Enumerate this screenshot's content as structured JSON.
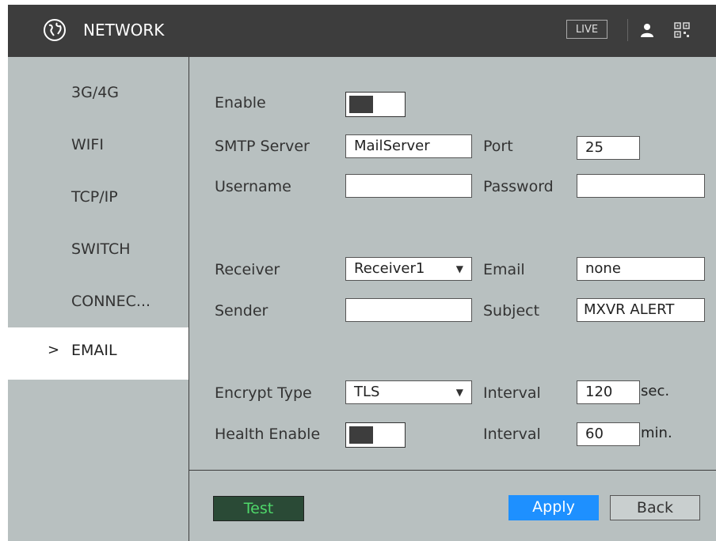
{
  "header": {
    "title": "NETWORK",
    "live_label": "LIVE"
  },
  "sidebar": {
    "items": [
      {
        "label": "3G/4G"
      },
      {
        "label": "WIFI"
      },
      {
        "label": "TCP/IP"
      },
      {
        "label": "SWITCH"
      },
      {
        "label": "CONNEC..."
      },
      {
        "label": "EMAIL",
        "chevron": ">"
      }
    ]
  },
  "form": {
    "enable_label": "Enable",
    "smtp_server_label": "SMTP Server",
    "smtp_server_value": "MailServer",
    "port_label": "Port",
    "port_value": "25",
    "username_label": "Username",
    "username_value": "",
    "password_label": "Password",
    "password_value": "",
    "receiver_label": "Receiver",
    "receiver_value": "Receiver1",
    "email_label": "Email",
    "email_value": "none",
    "sender_label": "Sender",
    "sender_value": "",
    "subject_label": "Subject",
    "subject_value": "MXVR ALERT",
    "encrypt_label": "Encrypt Type",
    "encrypt_value": "TLS",
    "interval_label": "Interval",
    "interval_value": "120",
    "interval_unit": "sec.",
    "health_label": "Health Enable",
    "health_interval_label": "Interval",
    "health_interval_value": "60",
    "health_interval_unit": "min."
  },
  "buttons": {
    "test": "Test",
    "apply": "Apply",
    "back": "Back"
  },
  "colors": {
    "header_bg": "#3d3d3d",
    "panel_bg": "#b8c0c0",
    "apply": "#1e90ff",
    "test_text": "#4fd86a"
  }
}
